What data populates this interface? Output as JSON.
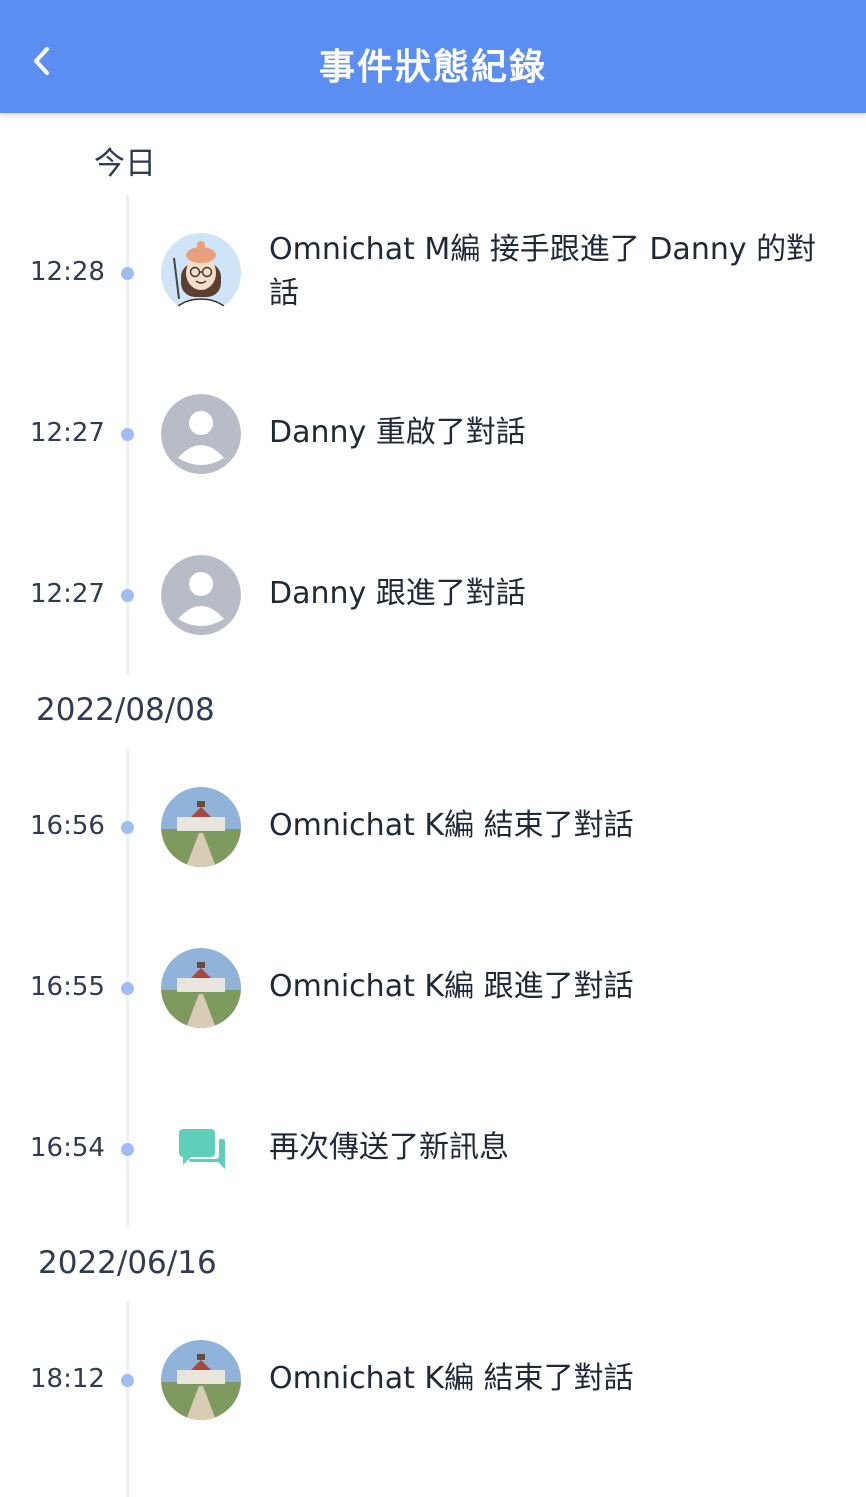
{
  "header": {
    "title": "事件狀態紀錄",
    "back_icon": "chevron-left-icon",
    "color": "#5b8ef0"
  },
  "groups": [
    {
      "date": "今日",
      "events": [
        {
          "time": "12:28",
          "text": "Omnichat M編 接手跟進了 Danny 的對話",
          "avatar": "cartoon-avatar"
        },
        {
          "time": "12:27",
          "text": "Danny 重啟了對話",
          "avatar": "default-user-avatar"
        },
        {
          "time": "12:27",
          "text": "Danny 跟進了對話",
          "avatar": "default-user-avatar"
        }
      ]
    },
    {
      "date": "2022/08/08",
      "events": [
        {
          "time": "16:56",
          "text": "Omnichat K編 結束了對話",
          "avatar": "building-photo-avatar"
        },
        {
          "time": "16:55",
          "text": "Omnichat K編 跟進了對話",
          "avatar": "building-photo-avatar"
        },
        {
          "time": "16:54",
          "text": "再次傳送了新訊息",
          "avatar": "chat-bubbles-icon"
        }
      ]
    },
    {
      "date": "2022/06/16",
      "events": [
        {
          "time": "18:12",
          "text": "Omnichat K編 結束了對話",
          "avatar": "building-photo-avatar"
        }
      ]
    }
  ]
}
